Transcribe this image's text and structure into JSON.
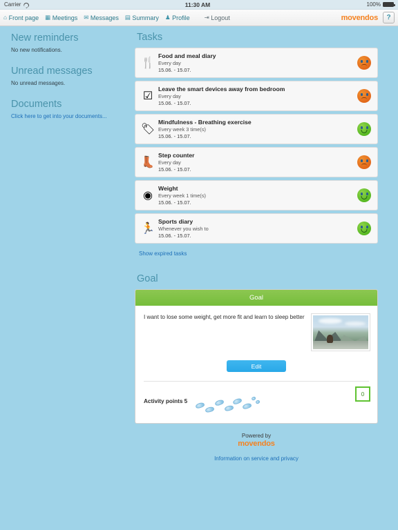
{
  "status_bar": {
    "carrier": "Carrier",
    "wifi_icon": "wifi-icon",
    "time": "11:30 AM",
    "battery_text": "100%",
    "battery_icon": "battery-full-icon"
  },
  "navbar": {
    "items": [
      {
        "label": "Front page",
        "icon": "home-icon",
        "glyph": "⌂"
      },
      {
        "label": "Meetings",
        "icon": "calendar-icon",
        "glyph": "▦"
      },
      {
        "label": "Messages",
        "icon": "envelope-icon",
        "glyph": "✉"
      },
      {
        "label": "Summary",
        "icon": "chart-bars-icon",
        "glyph": "▤"
      },
      {
        "label": "Profile",
        "icon": "user-icon",
        "glyph": "♟"
      }
    ],
    "logout": {
      "label": "Logout",
      "icon": "logout-icon",
      "glyph": "⇥"
    },
    "brand": "movendos",
    "help_label": "?",
    "brand_color": "#f58220",
    "link_color": "#2b7a8c"
  },
  "sidebar": {
    "blocks": [
      {
        "heading": "New reminders",
        "text": "No new notifications."
      },
      {
        "heading": "Unread messages",
        "text": "No unread messages."
      }
    ],
    "documents": {
      "heading": "Documents",
      "link": "Click here to get into your documents..."
    }
  },
  "tasks_section": {
    "title": "Tasks",
    "show_expired": "Show expired tasks",
    "tasks": [
      {
        "title": "Food and meal diary",
        "frequency": "Every day",
        "dates": "15.06. - 15.07.",
        "icon": "fork-knife-icon",
        "glyph": "🍴",
        "status": "orange",
        "status_name": "sad-smiley-icon"
      },
      {
        "title": "Leave the smart devices away from bedroom",
        "frequency": "Every day",
        "dates": "15.06. - 15.07.",
        "icon": "checkbox-checked-icon",
        "glyph": "☑",
        "status": "orange",
        "status_name": "sad-smiley-icon"
      },
      {
        "title": "Mindfulness - Breathing exercise",
        "frequency": "Every week 3 time(s)",
        "dates": "15.06. - 15.07.",
        "icon": "tag-icon",
        "glyph": "🏷",
        "status": "green",
        "status_name": "happy-smiley-icon"
      },
      {
        "title": "Step counter",
        "frequency": "Every day",
        "dates": "15.06. - 15.07.",
        "icon": "boot-icon",
        "glyph": "👢",
        "status": "orange",
        "status_name": "sad-smiley-icon"
      },
      {
        "title": "Weight",
        "frequency": "Every week 1 time(s)",
        "dates": "15.06. - 15.07.",
        "icon": "scale-icon",
        "glyph": "◉",
        "status": "green",
        "status_name": "happy-smiley-icon"
      },
      {
        "title": "Sports diary",
        "frequency": "Whenever you wish to",
        "dates": "15.06. - 15.07.",
        "icon": "runner-icon",
        "glyph": "🏃",
        "status": "green",
        "status_name": "happy-smiley-icon"
      }
    ]
  },
  "goal_section": {
    "title": "Goal",
    "panel_header": "Goal",
    "goal_text": "I want to lose some weight, get more fit and learn to sleep better",
    "photo_alt": "mountain-landscape-photo",
    "edit_label": "Edit",
    "points_label": "Activity points 5",
    "points_badge": "0",
    "header_color": "#7cbf41",
    "edit_color": "#2da8e8",
    "badge_border_color": "#5fc231"
  },
  "footer": {
    "powered_by": "Powered by",
    "brand": "movendos",
    "link": "Information on service and privacy"
  }
}
